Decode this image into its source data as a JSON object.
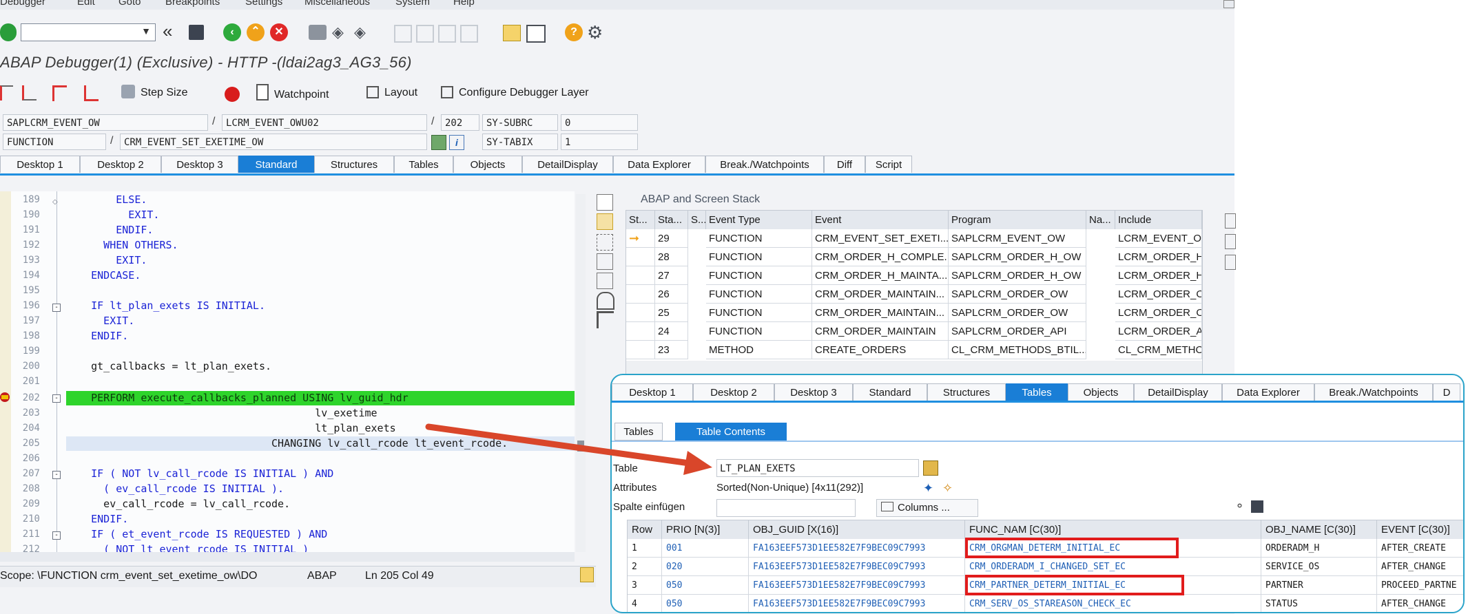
{
  "menu": [
    "Debugger",
    "Edit",
    "Goto",
    "Breakpoints",
    "Settings",
    "Miscellaneous",
    "System",
    "Help"
  ],
  "title": "ABAP Debugger(1)  (Exclusive) - HTTP -(ldai2ag3_AG3_56)",
  "appbar": {
    "step_size": "Step Size",
    "watchpoint": "Watchpoint",
    "layout": "Layout",
    "configure": "Configure Debugger Layer"
  },
  "context": {
    "program": "SAPLCRM_EVENT_OW",
    "include": "LCRM_EVENT_OWU02",
    "line": "202",
    "subrc_label": "SY-SUBRC",
    "subrc_value": "0",
    "type": "FUNCTION",
    "name": "CRM_EVENT_SET_EXETIME_OW",
    "tabix_label": "SY-TABIX",
    "tabix_value": "1",
    "slash": "/"
  },
  "tabs": [
    "Desktop 1",
    "Desktop 2",
    "Desktop 3",
    "Standard",
    "Structures",
    "Tables",
    "Objects",
    "DetailDisplay",
    "Data Explorer",
    "Break./Watchpoints",
    "Diff",
    "Script"
  ],
  "code": {
    "numbers": [
      "189",
      "190",
      "191",
      "192",
      "193",
      "194",
      "195",
      "196",
      "197",
      "198",
      "199",
      "200",
      "201",
      "202",
      "203",
      "204",
      "205",
      "206",
      "207",
      "208",
      "209",
      "210",
      "211",
      "212"
    ],
    "l189": "        ELSE.",
    "l190": "          EXIT.",
    "l191": "        ENDIF.",
    "l192": "      WHEN OTHERS.",
    "l193": "        EXIT.",
    "l194": "    ENDCASE.",
    "l196": "    IF lt_plan_exets IS INITIAL.",
    "l197": "      EXIT.",
    "l198": "    ENDIF.",
    "l200": "    gt_callbacks = lt_plan_exets.",
    "l202": "    PERFORM execute_callbacks_planned USING lv_guid_hdr",
    "l203": "                                        lv_exetime",
    "l204": "                                        lt_plan_exets",
    "l205": "                                 CHANGING lv_call_rcode lt_event_rcode.",
    "l207": "    IF ( NOT lv_call_rcode IS INITIAL ) AND",
    "l208": "      ( ev_call_rcode IS INITIAL ).",
    "l209": "      ev_call_rcode = lv_call_rcode.",
    "l210": "    ENDIF.",
    "l211": "    IF ( et_event_rcode IS REQUESTED ) AND",
    "l212": "      ( NOT lt_event_rcode IS INITIAL )"
  },
  "status": {
    "scope": "Scope: \\FUNCTION crm_event_set_exetime_ow\\DO",
    "lang": "ABAP",
    "pos": "Ln 205 Col  49"
  },
  "stack": {
    "title": "ABAP and Screen Stack",
    "headers": [
      "St...",
      "Sta...",
      "S...",
      "Event Type",
      "Event",
      "Program",
      "Na...",
      "Include"
    ],
    "rows": [
      [
        "29",
        "FUNCTION",
        "CRM_EVENT_SET_EXETI...",
        "SAPLCRM_EVENT_OW",
        "LCRM_EVENT_O"
      ],
      [
        "28",
        "FUNCTION",
        "CRM_ORDER_H_COMPLE...",
        "SAPLCRM_ORDER_H_OW",
        "LCRM_ORDER_H"
      ],
      [
        "27",
        "FUNCTION",
        "CRM_ORDER_H_MAINTA...",
        "SAPLCRM_ORDER_H_OW",
        "LCRM_ORDER_H"
      ],
      [
        "26",
        "FUNCTION",
        "CRM_ORDER_MAINTAIN...",
        "SAPLCRM_ORDER_OW",
        "LCRM_ORDER_O"
      ],
      [
        "25",
        "FUNCTION",
        "CRM_ORDER_MAINTAIN...",
        "SAPLCRM_ORDER_OW",
        "LCRM_ORDER_O"
      ],
      [
        "24",
        "FUNCTION",
        "CRM_ORDER_MAINTAIN",
        "SAPLCRM_ORDER_API",
        "LCRM_ORDER_A"
      ],
      [
        "23",
        "METHOD",
        "CREATE_ORDERS",
        "CL_CRM_METHODS_BTIL...",
        "CL_CRM_METHO"
      ]
    ]
  },
  "overlay": {
    "tabs": [
      "Desktop 1",
      "Desktop 2",
      "Desktop 3",
      "Standard",
      "Structures",
      "Tables",
      "Objects",
      "DetailDisplay",
      "Data Explorer",
      "Break./Watchpoints",
      "D"
    ],
    "subtabs": [
      "Tables",
      "Table Contents"
    ],
    "table_label": "Table",
    "table_value": "LT_PLAN_EXETS",
    "attributes_label": "Attributes",
    "attributes_value": "Sorted(Non-Unique) [4x11(292)]",
    "spalte_label": "Spalte einfügen",
    "columns_btn": "Columns ...",
    "headers": [
      "Row",
      "PRIO [N(3)]",
      "OBJ_GUID [X(16)]",
      "FUNC_NAM [C(30)]",
      "OBJ_NAME [C(30)]",
      "EVENT [C(30)]"
    ],
    "rows": [
      [
        "1",
        "001",
        "FA163EEF573D1EE582E7F9BEC09C7993",
        "CRM_ORGMAN_DETERM_INITIAL_EC",
        "ORDERADM_H",
        "AFTER_CREATE"
      ],
      [
        "2",
        "020",
        "FA163EEF573D1EE582E7F9BEC09C7993",
        "CRM_ORDERADM_I_CHANGED_SET_EC",
        "SERVICE_OS",
        "AFTER_CHANGE"
      ],
      [
        "3",
        "050",
        "FA163EEF573D1EE582E7F9BEC09C7993",
        "CRM_PARTNER_DETERM_INITIAL_EC",
        "PARTNER",
        "PROCEED_PARTNE"
      ],
      [
        "4",
        "050",
        "FA163EEF573D1EE582E7F9BEC09C7993",
        "CRM_SERV_OS_STAREASON_CHECK_EC",
        "STATUS",
        "AFTER_CHANGE"
      ]
    ]
  },
  "colors": {
    "accent": "#1a7ed6",
    "highlight": "#2ed42b",
    "annotation": "#d9462a"
  }
}
